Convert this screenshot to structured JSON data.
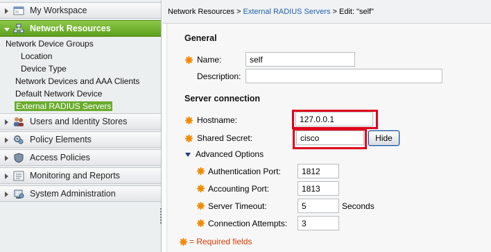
{
  "sidebar": {
    "sections": [
      {
        "label": "My Workspace",
        "icon": "workspace-icon"
      },
      {
        "label": "Network Resources",
        "icon": "network-icon"
      },
      {
        "label": "Users and Identity Stores",
        "icon": "users-icon"
      },
      {
        "label": "Policy Elements",
        "icon": "policy-elements-icon"
      },
      {
        "label": "Access Policies",
        "icon": "access-policies-icon"
      },
      {
        "label": "Monitoring and Reports",
        "icon": "monitoring-icon"
      },
      {
        "label": "System Administration",
        "icon": "system-admin-icon"
      }
    ],
    "network_items": [
      "Network Device Groups",
      "Location",
      "Device Type",
      "Network Devices and AAA Clients",
      "Default Network Device",
      "External RADIUS Servers"
    ],
    "accent": "#6aab2d"
  },
  "breadcrumb": {
    "part1": "Network Resources >",
    "part2": "External RADIUS Servers",
    "part3": "> Edit: \"self\""
  },
  "general": {
    "title": "General",
    "name_label": "Name:",
    "name_value": "self",
    "description_label": "Description:",
    "description_value": ""
  },
  "server": {
    "title": "Server connection",
    "hostname_label": "Hostname:",
    "hostname_value": "127.0.0.1",
    "secret_label": "Shared Secret:",
    "secret_value": "cisco",
    "hide_button": "Hide",
    "advanced_label": "Advanced Options",
    "auth_port_label": "Authentication Port:",
    "auth_port_value": "1812",
    "acct_port_label": "Accounting Port:",
    "acct_port_value": "1813",
    "timeout_label": "Server Timeout:",
    "timeout_value": "5",
    "timeout_unit": "Seconds",
    "attempts_label": "Connection Attempts:",
    "attempts_value": "3"
  },
  "required_note": "= Required fields",
  "colors": {
    "highlight": "#e0001b",
    "link": "#1d60b3",
    "required": "#d43a00"
  }
}
